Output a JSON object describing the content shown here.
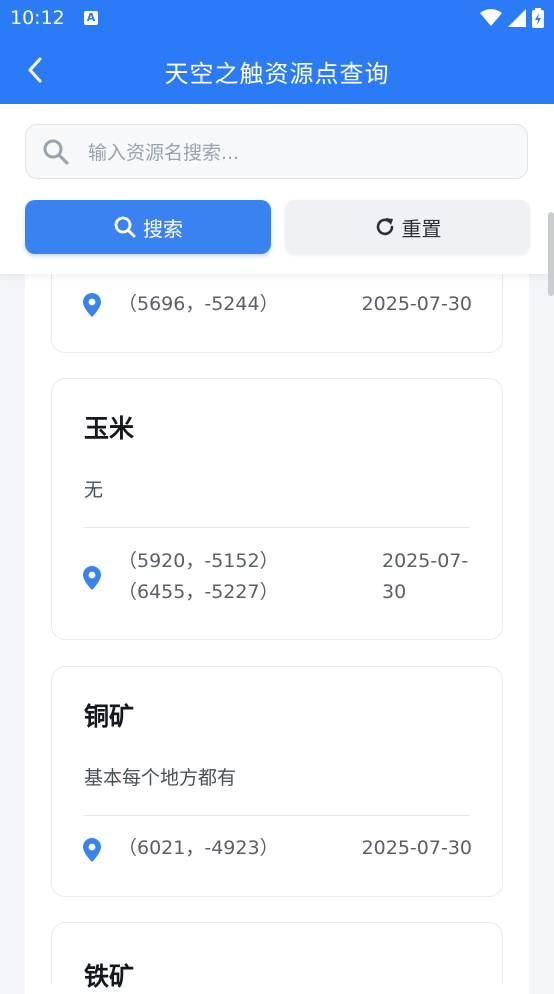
{
  "status": {
    "time": "10:12"
  },
  "header": {
    "title": "天空之触资源点查询"
  },
  "search": {
    "placeholder": "输入资源名搜索...",
    "value": ""
  },
  "buttons": {
    "search_label": "搜索",
    "reset_label": "重置"
  },
  "items": [
    {
      "name": "",
      "desc": "",
      "coords": [
        "（5696，-5244）"
      ],
      "date": "2025-07-30"
    },
    {
      "name": "玉米",
      "desc": "无",
      "coords": [
        "（5920，-5152）",
        "（6455，-5227）"
      ],
      "date": "2025-07-30",
      "date_lines": [
        "2025-07-",
        "30"
      ]
    },
    {
      "name": "铜矿",
      "desc": "基本每个地方都有",
      "coords": [
        "（6021，-4923）"
      ],
      "date": "2025-07-30"
    },
    {
      "name": "铁矿"
    }
  ],
  "colors": {
    "primary": "#2b7bf7",
    "pin": "#3a82f0"
  }
}
